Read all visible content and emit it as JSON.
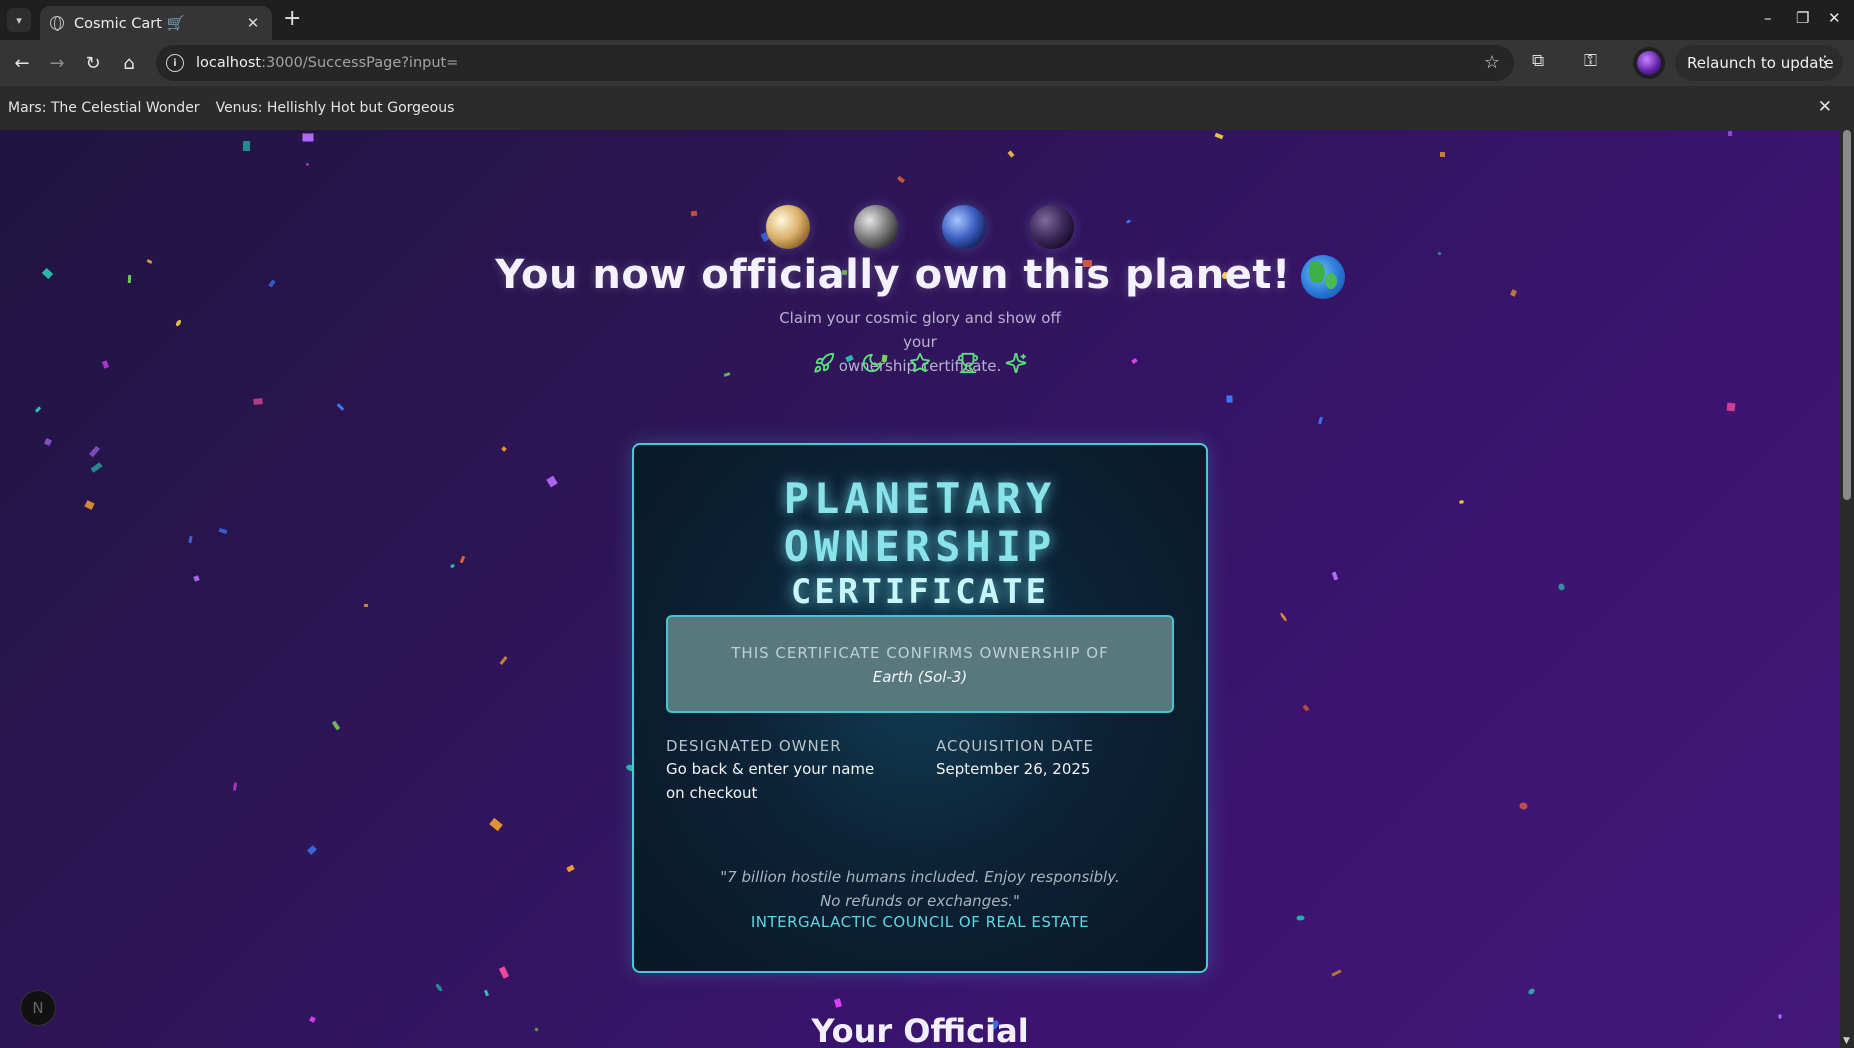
{
  "browser": {
    "tab_title": "Cosmic Cart 🛒",
    "new_tab": "+",
    "url_host": "localhost",
    "url_path": ":3000/SuccessPage?input=",
    "relaunch_label": "Relaunch to update"
  },
  "bookmarks": [
    "Mars: The Celestial Wonder",
    "Venus: Hellishly Hot but Gorgeous"
  ],
  "hero": {
    "headline": "You now officially own this planet!",
    "subtitle_line1": "Claim your cosmic glory and show off your",
    "subtitle_line2": "ownership certificate."
  },
  "icons": [
    "rocket-icon",
    "moon-icon",
    "star-icon",
    "trophy-icon",
    "sparkles-icon"
  ],
  "certificate": {
    "title_line1": "PLANETARY",
    "title_line2": "OWNERSHIP",
    "title_line3": "CERTIFICATE",
    "confirm_label": "THIS CERTIFICATE CONFIRMS OWNERSHIP OF",
    "planet": "Earth (Sol-3)",
    "owner_label": "DESIGNATED OWNER",
    "owner_value": "Go back & enter your name on checkout",
    "date_label": "ACQUISITION DATE",
    "date_value": "September 26, 2025",
    "quote_line1": "\"7 billion hostile humans included. Enjoy responsibly.",
    "quote_line2": "No refunds or exchanges.\"",
    "issuer": "INTERGALACTIC COUNCIL OF REAL ESTATE"
  },
  "next_section": {
    "heading": "Your Official"
  },
  "dev_badge": "N",
  "colors": {
    "accent": "#48c9d8",
    "title_glow": "#8be3ea",
    "background_start": "#1f1540",
    "background_end": "#44177a"
  }
}
